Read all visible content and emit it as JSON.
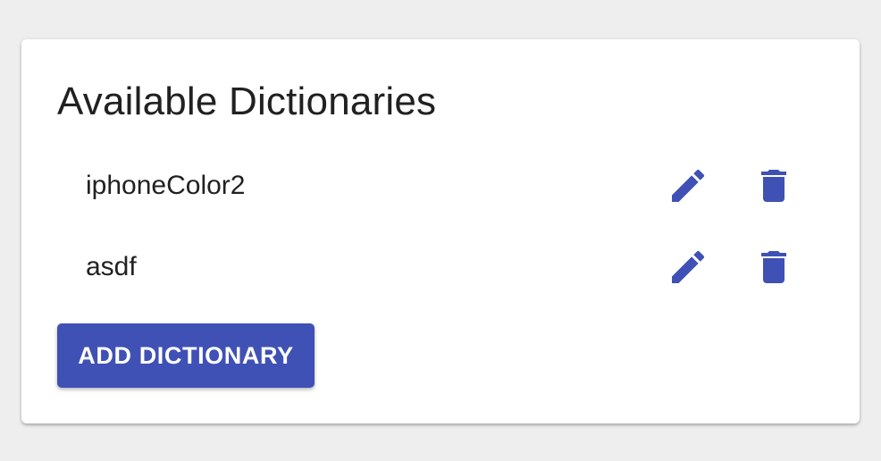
{
  "theme": {
    "accent": "#3f51b5",
    "background": "#eeeeee",
    "card": "#ffffff",
    "text": "#212121"
  },
  "card": {
    "title": "Available Dictionaries",
    "dictionaries": [
      {
        "name": "iphoneColor2",
        "edit_icon": "pencil-icon",
        "delete_icon": "trash-icon"
      },
      {
        "name": "asdf",
        "edit_icon": "pencil-icon",
        "delete_icon": "trash-icon"
      }
    ],
    "add_button_label": "ADD DICTIONARY"
  }
}
